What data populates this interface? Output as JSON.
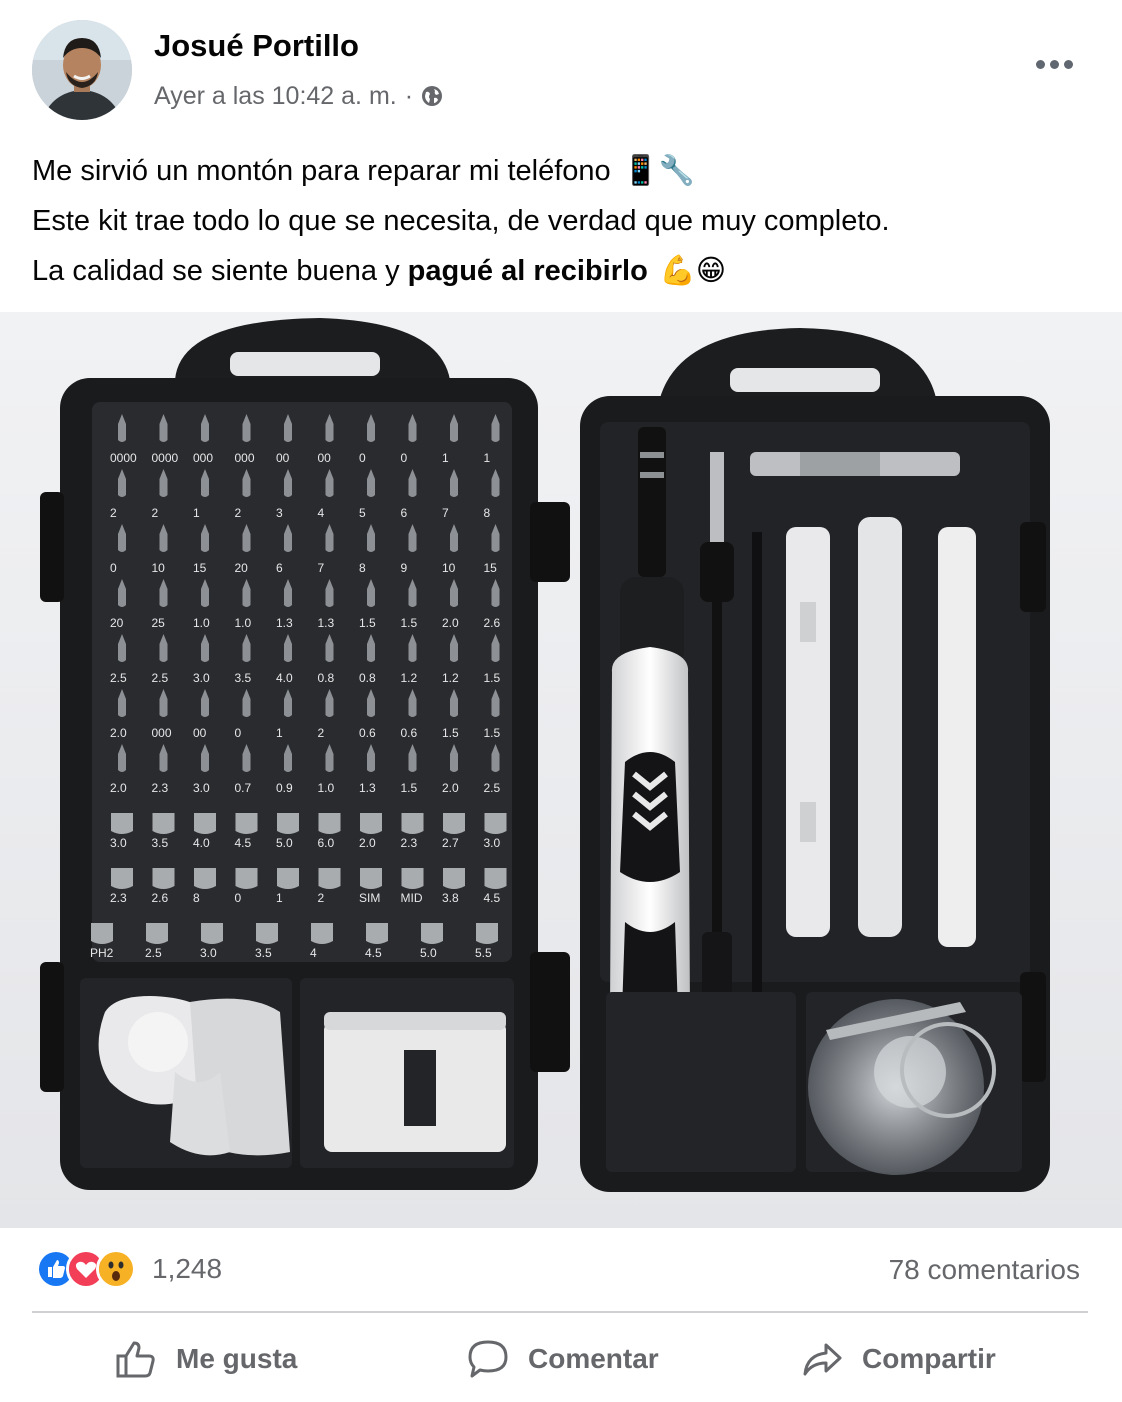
{
  "author": {
    "name": "Josué Portillo",
    "timestamp": "Ayer a las 10:42 a. m.",
    "separator": "·",
    "privacy_icon": "globe-icon"
  },
  "post": {
    "line1": "Me sirvió un montón para reparar mi teléfono",
    "line1_emoji": "📱🔧",
    "line2": "Este kit trae todo lo que se necesita, de verdad que muy completo.",
    "line3_prefix": "La calidad se siente buena y ",
    "line3_bold": "pagué al recibirlo",
    "line3_emoji": "💪😁"
  },
  "photo": {
    "bit_labels": [
      [
        "0000",
        "0000",
        "000",
        "000",
        "00",
        "00",
        "0",
        "0",
        "1",
        "1"
      ],
      [
        "2",
        "2",
        "1",
        "2",
        "3",
        "4",
        "5",
        "6",
        "7",
        "8"
      ],
      [
        "0",
        "10",
        "15",
        "20",
        "6",
        "7",
        "8",
        "9",
        "10",
        "15"
      ],
      [
        "20",
        "25",
        "1.0",
        "1.0",
        "1.3",
        "1.3",
        "1.5",
        "1.5",
        "2.0",
        "2.6"
      ],
      [
        "2.5",
        "2.5",
        "3.0",
        "3.5",
        "4.0",
        "0.8",
        "0.8",
        "1.2",
        "1.2",
        "1.5"
      ],
      [
        "2.0",
        "000",
        "00",
        "0",
        "1",
        "2",
        "0.6",
        "0.6",
        "1.5",
        "1.5"
      ],
      [
        "2.0",
        "2.3",
        "3.0",
        "0.7",
        "0.9",
        "1.0",
        "1.3",
        "1.5",
        "2.0",
        "2.5"
      ],
      [
        "3.0",
        "3.5",
        "4.0",
        "4.5",
        "5.0",
        "6.0",
        "2.0",
        "2.3",
        "2.7",
        "3.0"
      ],
      [
        "2.3",
        "2.6",
        "8",
        "0",
        "1",
        "2",
        "SIM",
        "MID",
        "3.8",
        "4.5"
      ],
      [
        "PH2",
        "2.5",
        "3.0",
        "3.5",
        "4",
        "4.5",
        "5.0",
        "5.5"
      ]
    ]
  },
  "engagement": {
    "reaction_icons": [
      "like-icon",
      "love-icon",
      "wow-icon"
    ],
    "reaction_count": "1,248",
    "comments": "78 comentarios"
  },
  "actions": {
    "like": "Me gusta",
    "comment": "Comentar",
    "share": "Compartir"
  },
  "colors": {
    "like_blue": "#1877f2",
    "love_red": "#f33e58",
    "wow_yellow": "#f7b125",
    "secondary_text": "#65676b",
    "divider": "#ced0d4"
  }
}
